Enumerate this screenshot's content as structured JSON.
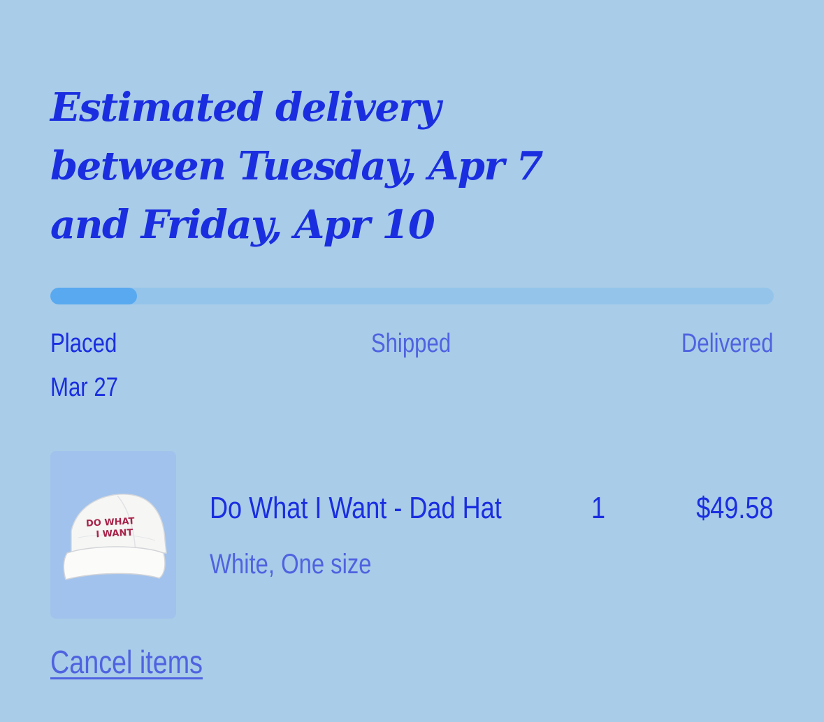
{
  "delivery": {
    "headline": "Estimated delivery between Tuesday, Apr 7 and Friday, Apr 10"
  },
  "progress": {
    "fraction": 0.12,
    "track_color": "#94c4ea",
    "fill_color": "#58a9f0",
    "steps": [
      {
        "label": "Placed",
        "date": "Mar 27",
        "active": true
      },
      {
        "label": "Shipped",
        "active": false
      },
      {
        "label": "Delivered",
        "active": false
      }
    ]
  },
  "item": {
    "name": "Do What I Want - Dad Hat",
    "quantity": "1",
    "price": "$49.58",
    "variant": "White, One size",
    "image": {
      "icon": "white-dad-hat-image",
      "embroidery_line1": "DO WHAT",
      "embroidery_line2": "I WANT",
      "embroidery_color": "#a8244a"
    }
  },
  "actions": {
    "cancel_label": "Cancel items"
  },
  "colors": {
    "background": "#a9cce8",
    "primary_text": "#1a2ee0",
    "secondary_text": "#4f63e0"
  }
}
